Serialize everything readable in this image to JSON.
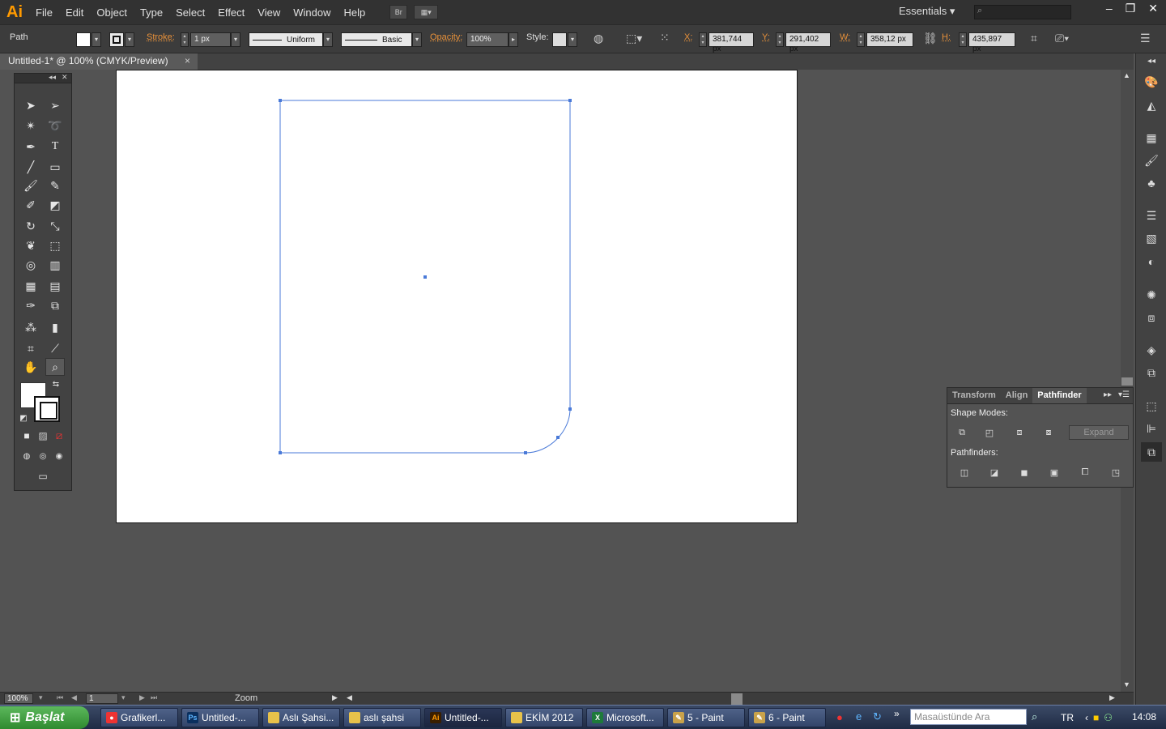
{
  "app": {
    "logo": "Ai",
    "menu": [
      "File",
      "Edit",
      "Object",
      "Type",
      "Select",
      "Effect",
      "View",
      "Window",
      "Help"
    ],
    "bridge_button": "Br",
    "workspace": "Essentials",
    "search_placeholder": "",
    "window_controls": [
      "–",
      "❐",
      "✕"
    ]
  },
  "control_bar": {
    "selection_type": "Path",
    "stroke_label": "Stroke:",
    "stroke_weight": "1 px",
    "variable_width": "Uniform",
    "brush_def": "Basic",
    "opacity_label": "Opacity:",
    "opacity_value": "100%",
    "style_label": "Style:",
    "x_label": "X:",
    "x_value": "381,744 px",
    "y_label": "Y:",
    "y_value": "291,402 px",
    "w_label": "W:",
    "w_value": "358,12 px",
    "h_label": "H:",
    "h_value": "435,897 px"
  },
  "document": {
    "tab_title": "Untitled-1* @ 100% (CMYK/Preview)",
    "close": "×"
  },
  "colors": {
    "selection": "#4a7ad8",
    "artboard": "#ffffff",
    "accent_orange": "#e8913a",
    "workspace_bg": "#535353"
  },
  "toolbox": {
    "collapse": "◂◂",
    "close": "✕",
    "tools": [
      "selection-tool",
      "direct-selection-tool",
      "magic-wand-tool",
      "lasso-tool",
      "pen-tool",
      "type-tool",
      "line-segment-tool",
      "rectangle-tool",
      "paintbrush-tool",
      "pencil-tool",
      "blob-brush-tool",
      "eraser-tool",
      "rotate-tool",
      "scale-tool",
      "warp-tool",
      "free-transform-tool",
      "shape-builder-tool",
      "perspective-grid-tool",
      "mesh-tool",
      "gradient-tool",
      "eyedropper-tool",
      "blend-tool",
      "symbol-sprayer-tool",
      "column-graph-tool",
      "artboard-tool",
      "slice-tool",
      "hand-tool",
      "zoom-tool"
    ]
  },
  "pathfinder": {
    "tabs": [
      "Transform",
      "Align",
      "Pathfinder"
    ],
    "active_tab": "Pathfinder",
    "shape_modes_label": "Shape Modes:",
    "pathfinders_label": "Pathfinders:",
    "expand_label": "Expand"
  },
  "status_bar": {
    "zoom": "100%",
    "artboard_number": "1",
    "tool_label": "Zoom"
  },
  "taskbar": {
    "start_label": "Başlat",
    "items": [
      {
        "label": "Grafikerl...",
        "icon": "chrome-icon"
      },
      {
        "label": "Untitled-...",
        "icon": "photoshop-icon"
      },
      {
        "label": "Aslı Şahsi...",
        "icon": "folder-icon"
      },
      {
        "label": "aslı şahsi",
        "icon": "folder-icon"
      },
      {
        "label": "Untitled-...",
        "icon": "illustrator-icon"
      },
      {
        "label": "EKİM 2012",
        "icon": "folder-icon"
      },
      {
        "label": "Microsoft...",
        "icon": "excel-icon"
      },
      {
        "label": "5 - Paint",
        "icon": "paint-icon"
      },
      {
        "label": "6 - Paint",
        "icon": "paint-icon"
      }
    ],
    "active_index": 4,
    "search_placeholder": "Masaüstünde Ara",
    "language": "TR",
    "clock": "14:08"
  }
}
